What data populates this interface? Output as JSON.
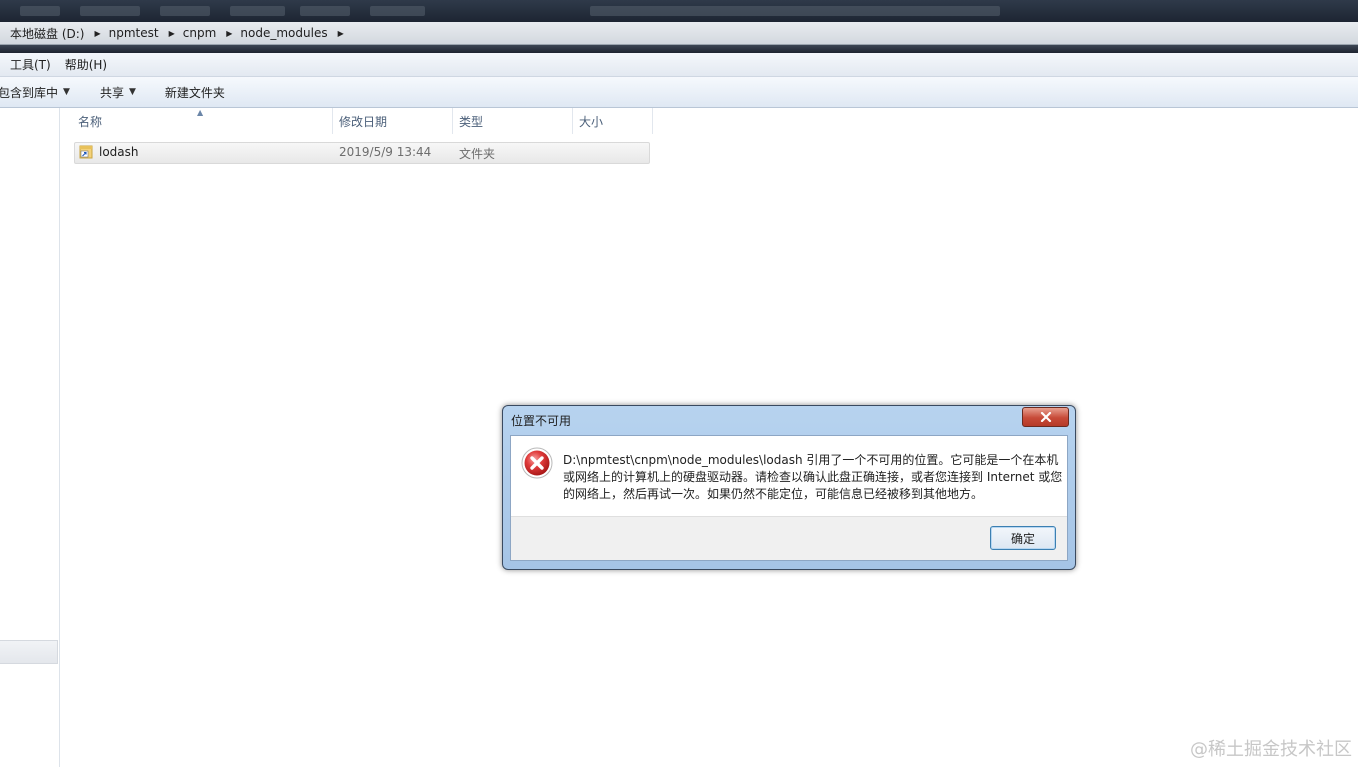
{
  "address_bar": {
    "crumbs": [
      "本地磁盘 (D:)",
      "npmtest",
      "cnpm",
      "node_modules"
    ]
  },
  "menu": {
    "tools": "工具(T)",
    "help": "帮助(H)"
  },
  "toolbar": {
    "include_library": "包含到库中",
    "share": "共享",
    "new_folder": "新建文件夹"
  },
  "columns": {
    "name": "名称",
    "modified": "修改日期",
    "type": "类型",
    "size": "大小"
  },
  "files": [
    {
      "name": "lodash",
      "modified": "2019/5/9 13:44",
      "type": "文件夹",
      "size": ""
    }
  ],
  "dialog": {
    "title": "位置不可用",
    "message": "D:\\npmtest\\cnpm\\node_modules\\lodash 引用了一个不可用的位置。它可能是一个在本机或网络上的计算机上的硬盘驱动器。请检查以确认此盘正确连接，或者您连接到 Internet 或您的网络上，然后再试一次。如果仍然不能定位，可能信息已经被移到其他地方。",
    "ok": "确定"
  },
  "watermark": "@稀土掘金技术社区",
  "colors": {
    "dialog_frame": "#a5c4e6",
    "close_button": "#c74a38",
    "error_icon": "#d32f2f"
  }
}
